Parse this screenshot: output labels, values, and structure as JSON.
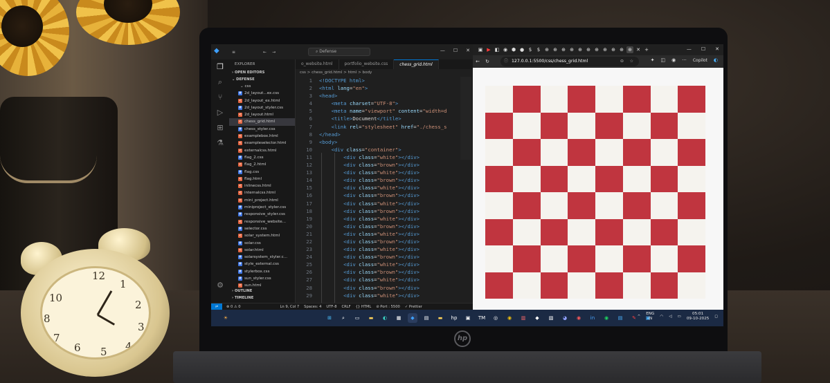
{
  "vscode": {
    "search_placeholder": "Defense",
    "explorer_title": "EXPLORER",
    "open_editors": "OPEN EDITORS",
    "folder_root": "DEFENSE",
    "folder_css": "css",
    "files": [
      {
        "name": "2d_layout...ex.css",
        "type": "css"
      },
      {
        "name": "2d_layout_ex.html",
        "type": "html"
      },
      {
        "name": "2d_layout_styler.css",
        "type": "css"
      },
      {
        "name": "2d_layout.html",
        "type": "html"
      },
      {
        "name": "chess_grid.html",
        "type": "html"
      },
      {
        "name": "chess_styler.css",
        "type": "css"
      },
      {
        "name": "examplebox.html",
        "type": "html"
      },
      {
        "name": "exampleselector.html",
        "type": "html"
      },
      {
        "name": "externalcss.html",
        "type": "html"
      },
      {
        "name": "flag_2.css",
        "type": "css"
      },
      {
        "name": "flag_2.html",
        "type": "html"
      },
      {
        "name": "flag.css",
        "type": "css"
      },
      {
        "name": "flag.html",
        "type": "html"
      },
      {
        "name": "inlinecss.html",
        "type": "html"
      },
      {
        "name": "internalcss.html",
        "type": "html"
      },
      {
        "name": "mini_project.html",
        "type": "html"
      },
      {
        "name": "miniproject_styler.css",
        "type": "css"
      },
      {
        "name": "responsive_styler.css",
        "type": "css"
      },
      {
        "name": "responsive_website...",
        "type": "html"
      },
      {
        "name": "selector.css",
        "type": "css"
      },
      {
        "name": "solar_system.html",
        "type": "html"
      },
      {
        "name": "solar.css",
        "type": "css"
      },
      {
        "name": "solar.html",
        "type": "html"
      },
      {
        "name": "solarsystem_styler.c...",
        "type": "css"
      },
      {
        "name": "style_external.css",
        "type": "css"
      },
      {
        "name": "stylerbox.css",
        "type": "css"
      },
      {
        "name": "sun_styler.css",
        "type": "css"
      },
      {
        "name": "sun.html",
        "type": "html"
      }
    ],
    "outline": "OUTLINE",
    "timeline": "TIMELINE",
    "tabs": [
      "o_website.html",
      "portfolio_website.css",
      "chess_grid.html"
    ],
    "breadcrumb": "css  >  chess_grid.html  >  html  >  body",
    "code_lines": [
      {
        "n": "1",
        "indent": "",
        "parts": [
          [
            "tag",
            "<!DOCTYPE html>"
          ]
        ]
      },
      {
        "n": "2",
        "indent": "",
        "parts": [
          [
            "tag",
            "<html "
          ],
          [
            "attr",
            "lang"
          ],
          [
            "txt",
            "="
          ],
          [
            "str",
            "\"en\""
          ],
          [
            "tag",
            ">"
          ]
        ]
      },
      {
        "n": "3",
        "indent": "",
        "parts": [
          [
            "tag",
            "<head>"
          ]
        ]
      },
      {
        "n": "4",
        "indent": "    ",
        "parts": [
          [
            "tag",
            "<meta "
          ],
          [
            "attr",
            "charset"
          ],
          [
            "txt",
            "="
          ],
          [
            "str",
            "\"UTF-8\""
          ],
          [
            "tag",
            ">"
          ]
        ]
      },
      {
        "n": "5",
        "indent": "    ",
        "parts": [
          [
            "tag",
            "<meta "
          ],
          [
            "attr",
            "name"
          ],
          [
            "txt",
            "="
          ],
          [
            "str",
            "\"viewport\""
          ],
          [
            "attr",
            " content"
          ],
          [
            "txt",
            "="
          ],
          [
            "str",
            "\"width=d"
          ]
        ]
      },
      {
        "n": "6",
        "indent": "    ",
        "parts": [
          [
            "tag",
            "<title>"
          ],
          [
            "txt",
            "Document"
          ],
          [
            "tag",
            "</title>"
          ]
        ]
      },
      {
        "n": "7",
        "indent": "    ",
        "parts": [
          [
            "tag",
            "<link "
          ],
          [
            "attr",
            "rel"
          ],
          [
            "txt",
            "="
          ],
          [
            "str",
            "\"stylesheet\""
          ],
          [
            "attr",
            " href"
          ],
          [
            "txt",
            "="
          ],
          [
            "str",
            "\"./chess_s"
          ]
        ]
      },
      {
        "n": "8",
        "indent": "",
        "parts": [
          [
            "tag",
            "</head>"
          ]
        ]
      },
      {
        "n": "9",
        "indent": "",
        "parts": [
          [
            "tag",
            "<body>"
          ]
        ]
      },
      {
        "n": "10",
        "indent": "    ",
        "parts": [
          [
            "tag",
            "<div "
          ],
          [
            "attr",
            "class"
          ],
          [
            "txt",
            "="
          ],
          [
            "str",
            "\"container\""
          ],
          [
            "tag",
            ">"
          ]
        ]
      },
      {
        "n": "11",
        "indent": "        ",
        "parts": [
          [
            "tag",
            "<div "
          ],
          [
            "attr",
            "class"
          ],
          [
            "txt",
            "="
          ],
          [
            "str",
            "\"white\""
          ],
          [
            "tag",
            "></div>"
          ]
        ]
      },
      {
        "n": "12",
        "indent": "        ",
        "parts": [
          [
            "tag",
            "<div "
          ],
          [
            "attr",
            "class"
          ],
          [
            "txt",
            "="
          ],
          [
            "str",
            "\"brown\""
          ],
          [
            "tag",
            "></div>"
          ]
        ]
      },
      {
        "n": "13",
        "indent": "        ",
        "parts": [
          [
            "tag",
            "<div "
          ],
          [
            "attr",
            "class"
          ],
          [
            "txt",
            "="
          ],
          [
            "str",
            "\"white\""
          ],
          [
            "tag",
            "></div>"
          ]
        ]
      },
      {
        "n": "14",
        "indent": "        ",
        "parts": [
          [
            "tag",
            "<div "
          ],
          [
            "attr",
            "class"
          ],
          [
            "txt",
            "="
          ],
          [
            "str",
            "\"brown\""
          ],
          [
            "tag",
            "></div>"
          ]
        ]
      },
      {
        "n": "15",
        "indent": "        ",
        "parts": [
          [
            "tag",
            "<div "
          ],
          [
            "attr",
            "class"
          ],
          [
            "txt",
            "="
          ],
          [
            "str",
            "\"white\""
          ],
          [
            "tag",
            "></div>"
          ]
        ]
      },
      {
        "n": "16",
        "indent": "        ",
        "parts": [
          [
            "tag",
            "<div "
          ],
          [
            "attr",
            "class"
          ],
          [
            "txt",
            "="
          ],
          [
            "str",
            "\"brown\""
          ],
          [
            "tag",
            "></div>"
          ]
        ]
      },
      {
        "n": "17",
        "indent": "        ",
        "parts": [
          [
            "tag",
            "<div "
          ],
          [
            "attr",
            "class"
          ],
          [
            "txt",
            "="
          ],
          [
            "str",
            "\"white\""
          ],
          [
            "tag",
            "></div>"
          ]
        ]
      },
      {
        "n": "18",
        "indent": "        ",
        "parts": [
          [
            "tag",
            "<div "
          ],
          [
            "attr",
            "class"
          ],
          [
            "txt",
            "="
          ],
          [
            "str",
            "\"brown\""
          ],
          [
            "tag",
            "></div>"
          ]
        ]
      },
      {
        "n": "19",
        "indent": "        ",
        "parts": [
          [
            "tag",
            "<div "
          ],
          [
            "attr",
            "class"
          ],
          [
            "txt",
            "="
          ],
          [
            "str",
            "\"white\""
          ],
          [
            "tag",
            "></div>"
          ]
        ]
      },
      {
        "n": "20",
        "indent": "        ",
        "parts": [
          [
            "tag",
            "<div "
          ],
          [
            "attr",
            "class"
          ],
          [
            "txt",
            "="
          ],
          [
            "str",
            "\"brown\""
          ],
          [
            "tag",
            "></div>"
          ]
        ]
      },
      {
        "n": "21",
        "indent": "        ",
        "parts": [
          [
            "tag",
            "<div "
          ],
          [
            "attr",
            "class"
          ],
          [
            "txt",
            "="
          ],
          [
            "str",
            "\"white\""
          ],
          [
            "tag",
            "></div>"
          ]
        ]
      },
      {
        "n": "22",
        "indent": "        ",
        "parts": [
          [
            "tag",
            "<div "
          ],
          [
            "attr",
            "class"
          ],
          [
            "txt",
            "="
          ],
          [
            "str",
            "\"brown\""
          ],
          [
            "tag",
            "></div>"
          ]
        ]
      },
      {
        "n": "23",
        "indent": "        ",
        "parts": [
          [
            "tag",
            "<div "
          ],
          [
            "attr",
            "class"
          ],
          [
            "txt",
            "="
          ],
          [
            "str",
            "\"white\""
          ],
          [
            "tag",
            "></div>"
          ]
        ]
      },
      {
        "n": "24",
        "indent": "        ",
        "parts": [
          [
            "tag",
            "<div "
          ],
          [
            "attr",
            "class"
          ],
          [
            "txt",
            "="
          ],
          [
            "str",
            "\"brown\""
          ],
          [
            "tag",
            "></div>"
          ]
        ]
      },
      {
        "n": "25",
        "indent": "        ",
        "parts": [
          [
            "tag",
            "<div "
          ],
          [
            "attr",
            "class"
          ],
          [
            "txt",
            "="
          ],
          [
            "str",
            "\"white\""
          ],
          [
            "tag",
            "></div>"
          ]
        ]
      },
      {
        "n": "26",
        "indent": "        ",
        "parts": [
          [
            "tag",
            "<div "
          ],
          [
            "attr",
            "class"
          ],
          [
            "txt",
            "="
          ],
          [
            "str",
            "\"brown\""
          ],
          [
            "tag",
            "></div>"
          ]
        ]
      },
      {
        "n": "27",
        "indent": "        ",
        "parts": [
          [
            "tag",
            "<div "
          ],
          [
            "attr",
            "class"
          ],
          [
            "txt",
            "="
          ],
          [
            "str",
            "\"white\""
          ],
          [
            "tag",
            "></div>"
          ]
        ]
      },
      {
        "n": "28",
        "indent": "        ",
        "parts": [
          [
            "tag",
            "<div "
          ],
          [
            "attr",
            "class"
          ],
          [
            "txt",
            "="
          ],
          [
            "str",
            "\"brown\""
          ],
          [
            "tag",
            "></div>"
          ]
        ]
      },
      {
        "n": "29",
        "indent": "        ",
        "parts": [
          [
            "tag",
            "<div "
          ],
          [
            "attr",
            "class"
          ],
          [
            "txt",
            "="
          ],
          [
            "str",
            "\"white\""
          ],
          [
            "tag",
            "></div>"
          ]
        ]
      }
    ],
    "status": {
      "errors": "⊗ 0 ⚠ 0",
      "cursor": "Ln 9, Col 7",
      "spaces": "Spaces: 4",
      "encoding": "UTF-8",
      "eol": "CRLF",
      "language": "{} HTML",
      "port": "⊘ Port : 5500",
      "prettier": "✓ Prettier"
    }
  },
  "browser": {
    "url": "127.0.0.1:5500/css/chess_grid.html",
    "copilot": "Copilot",
    "board": {
      "rows": 8,
      "cols": 8,
      "light_color": "#f5f3ee",
      "dark_color": "#c0353f"
    }
  },
  "taskbar": {
    "lang_top": "ENG",
    "lang_bottom": "IN",
    "time": "05:01",
    "date": "09-10-2025"
  },
  "colors": {
    "vscode_bg": "#1e1e1e",
    "accent": "#0078d4",
    "taskbar": "#1b2a44"
  }
}
